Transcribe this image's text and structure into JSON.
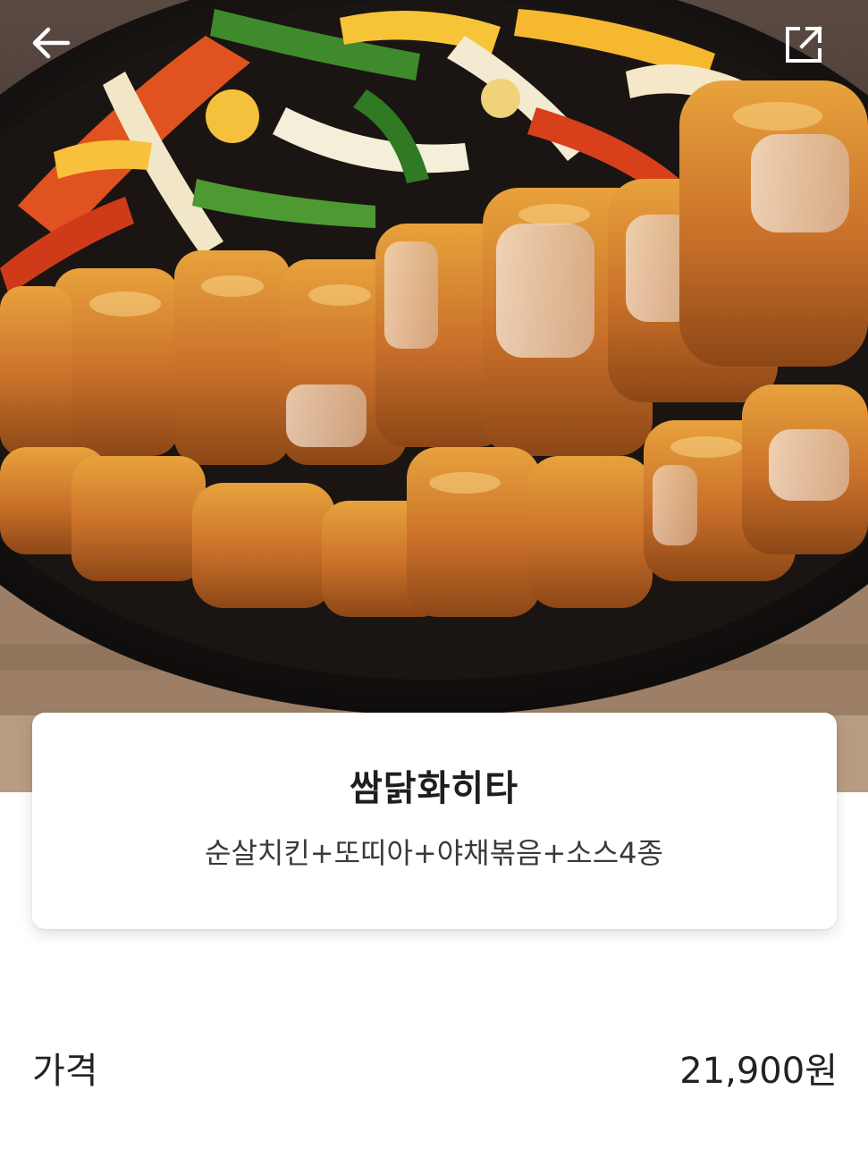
{
  "header": {
    "back_icon": "arrow-left-icon",
    "share_icon": "share-external-icon"
  },
  "hero_image": {
    "subject": "sizzling fajita chicken on cast-iron skillet"
  },
  "menu": {
    "name": "쌈닭화히타",
    "description": "순살치킨+또띠아+야채볶음+소스4종"
  },
  "price": {
    "label": "가격",
    "value": "21,900원"
  },
  "colors": {
    "background": "#ffffff",
    "text": "#222222",
    "icon": "#ffffff"
  }
}
